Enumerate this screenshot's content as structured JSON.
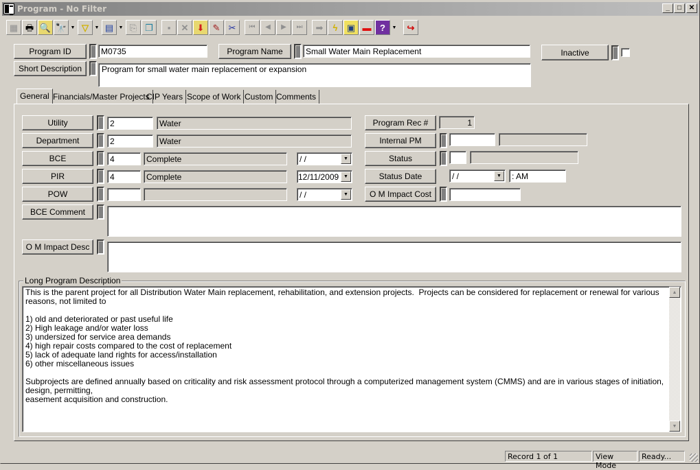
{
  "window": {
    "title": "Program - No Filter",
    "minimize": "_",
    "maximize": "□",
    "close": "✕"
  },
  "toolbar": {
    "buttons": [
      {
        "name": "form-view",
        "glyph": "▦"
      },
      {
        "name": "print",
        "glyph": "🖶"
      },
      {
        "name": "print-preview",
        "glyph": "🔍"
      },
      {
        "name": "find",
        "glyph": "🔭"
      },
      {
        "name": "filter",
        "glyph": "▽"
      },
      {
        "name": "report",
        "glyph": "▤"
      },
      {
        "name": "export",
        "glyph": "⎘"
      },
      {
        "name": "copy-document",
        "glyph": "❐"
      },
      {
        "name": "save",
        "glyph": "▪"
      },
      {
        "name": "delete",
        "glyph": "✕"
      },
      {
        "name": "add-record",
        "glyph": "⬇"
      },
      {
        "name": "edit",
        "glyph": "✎"
      },
      {
        "name": "cut",
        "glyph": "✂"
      },
      {
        "name": "first-record",
        "glyph": "⏮"
      },
      {
        "name": "previous-record",
        "glyph": "◀"
      },
      {
        "name": "next-record",
        "glyph": "▶"
      },
      {
        "name": "last-record",
        "glyph": "⏭"
      },
      {
        "name": "go-to",
        "glyph": "➡"
      },
      {
        "name": "run",
        "glyph": "ϟ"
      },
      {
        "name": "hierarchy",
        "glyph": "▣"
      },
      {
        "name": "toolbox",
        "glyph": "▬"
      },
      {
        "name": "help-book",
        "glyph": "?"
      },
      {
        "name": "exit",
        "glyph": "↪"
      }
    ]
  },
  "header": {
    "program_id_label": "Program ID",
    "program_id_value": "M0735",
    "program_name_label": "Program Name",
    "program_name_value": "Small Water Main Replacement",
    "inactive_label": "Inactive",
    "inactive_checked": false,
    "short_description_label": "Short Description",
    "short_description_value": "Program for small water main replacement or expansion"
  },
  "tabs": [
    {
      "label": "General",
      "active": true
    },
    {
      "label": "Financials/Master Projects",
      "active": false
    },
    {
      "label": "CIP Years",
      "active": false
    },
    {
      "label": "Scope of Work",
      "active": false
    },
    {
      "label": "Custom",
      "active": false
    },
    {
      "label": "Comments",
      "active": false
    }
  ],
  "general": {
    "utility": {
      "label": "Utility",
      "code": "2",
      "desc": "Water"
    },
    "department": {
      "label": "Department",
      "code": "2",
      "desc": "Water"
    },
    "bce": {
      "label": "BCE",
      "code": "4",
      "desc": "Complete",
      "date": " /  /"
    },
    "pir": {
      "label": "PIR",
      "code": "4",
      "desc": "Complete",
      "date": "12/11/2009"
    },
    "pow": {
      "label": "POW",
      "code": "",
      "desc": "",
      "date": " /  /"
    },
    "bce_comment": {
      "label": "BCE Comment",
      "value": ""
    },
    "om_impact_desc": {
      "label": "O M Impact Desc",
      "value": ""
    },
    "program_rec": {
      "label": "Program Rec #",
      "value": "1"
    },
    "internal_pm": {
      "label": "Internal PM",
      "code": "",
      "desc": ""
    },
    "status": {
      "label": "Status",
      "code": "",
      "desc": ""
    },
    "status_date": {
      "label": "Status Date",
      "date": " /  /",
      "time": " :  AM"
    },
    "om_impact_cost": {
      "label": "O M Impact Cost",
      "value": ""
    },
    "long_description": {
      "label": "Long Program Description",
      "value": "This is the parent project for all Distribution Water Main replacement, rehabilitation, and extension projects.  Projects can be considered for replacement or renewal for various reasons, not limited to\n\n1) old and deteriorated or past useful life\n2) High leakage and/or water loss\n3) undersized for service area demands\n4) high repair costs compared to the cost of replacement\n5) lack of adequate land rights for access/installation\n6) other miscellaneous issues\n\nSubprojects are defined annually based on criticality and risk assessment protocol through a computerized management system (CMMS) and are in various stages of initiation, design, permitting,\neasement acquisition and construction."
    }
  },
  "statusbar": {
    "record": "Record 1 of 1",
    "mode": "View Mode",
    "state": "Ready..."
  }
}
